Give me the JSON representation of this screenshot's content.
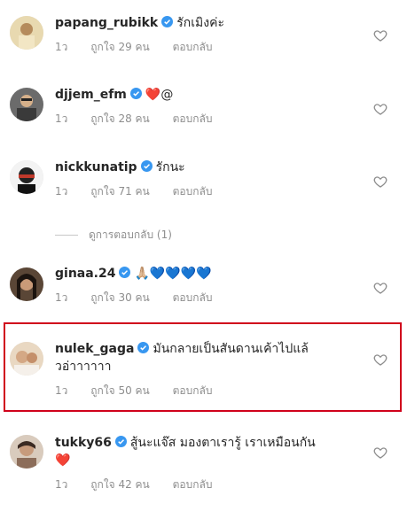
{
  "comments": [
    {
      "username": "papang_rubikk",
      "text": "รักเมิงค่ะ",
      "time": "1ว",
      "likes": "ถูกใจ 29 คน",
      "reply": "ตอบกลับ"
    },
    {
      "username": "djjem_efm",
      "text_emoji": "❤️",
      "text": "@",
      "time": "1ว",
      "likes": "ถูกใจ 28 คน",
      "reply": "ตอบกลับ"
    },
    {
      "username": "nickkunatip",
      "text": "รักนะ",
      "time": "1ว",
      "likes": "ถูกใจ 71 คน",
      "reply": "ตอบกลับ"
    },
    {
      "username": "ginaa.24",
      "text_emoji": "🙏🏼💙💙💙💙",
      "time": "1ว",
      "likes": "ถูกใจ 30 คน",
      "reply": "ตอบกลับ"
    },
    {
      "username": "nulek_gaga",
      "text": "มันกลายเป็นสันดานเค้าไปแล้",
      "text_line2": "วอ่าาาาาา",
      "time": "1ว",
      "likes": "ถูกใจ 50 คน",
      "reply": "ตอบกลับ"
    },
    {
      "username": "tukky66",
      "text": "สู้นะแจ๊ส มองตาเรารู้ เราเหมือนกัน",
      "text_emoji": "❤️",
      "time": "1ว",
      "likes": "ถูกใจ 42 คน",
      "reply": "ตอบกลับ"
    }
  ],
  "view_replies": "ดูการตอบกลับ (1)",
  "colors": {
    "verified": "#3897f0",
    "meta": "#8e8e8e",
    "highlight": "#d0021b"
  },
  "icons": {
    "verified": "verified-badge-icon",
    "like": "heart-outline-icon"
  }
}
